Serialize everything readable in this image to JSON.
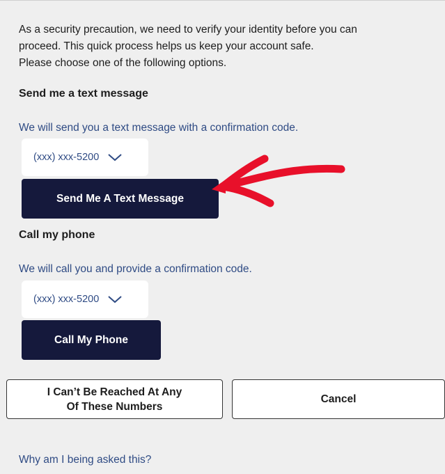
{
  "intro": {
    "line1": "As a security precaution, we need to verify your identity before you can",
    "line2": "proceed. This quick process helps us keep your account safe.",
    "line3": "Please choose one of the following options."
  },
  "text_section": {
    "heading": "Send me a text message",
    "description": "We will send you a text message with a confirmation code.",
    "phone_value": "(xxx) xxx-5200",
    "button_label": "Send Me A Text Message"
  },
  "call_section": {
    "heading": "Call my phone",
    "description": "We will call you and provide a confirmation code.",
    "phone_value": "(xxx) xxx-5200",
    "button_label": "Call My Phone"
  },
  "footer_buttons": {
    "unreachable_line1": "I Can’t Be Reached At Any",
    "unreachable_line2": "Of These Numbers",
    "cancel_label": "Cancel"
  },
  "help_link": "Why am I being asked this?",
  "colors": {
    "background": "#efefef",
    "primary_button": "#15193c",
    "link_text": "#2f4b84",
    "annotation_arrow": "#e8102a"
  },
  "icons": {
    "dropdown": "chevron-down-icon",
    "annotation": "red-arrow-icon"
  }
}
